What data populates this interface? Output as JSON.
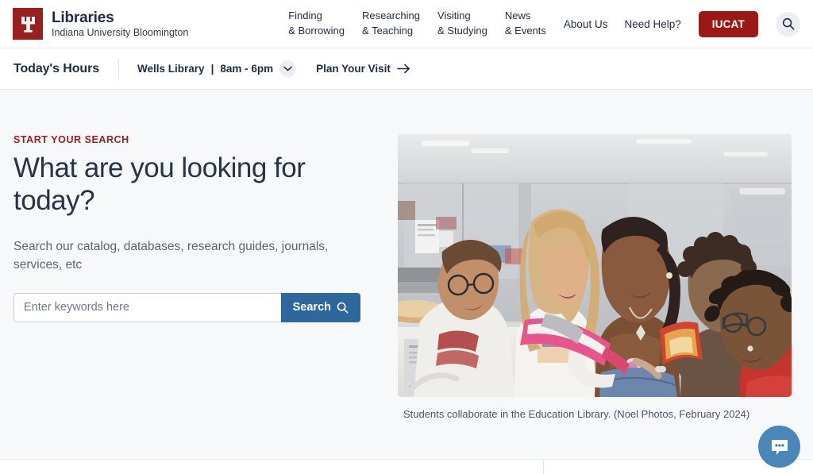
{
  "header": {
    "logo_alt": "Indiana University trident logo",
    "brand_title": "Libraries",
    "brand_subtitle": "Indiana University Bloomington",
    "nav_stacked": [
      {
        "line1": "Finding",
        "line2": "& Borrowing"
      },
      {
        "line1": "Researching",
        "line2": "& Teaching"
      },
      {
        "line1": "Visiting",
        "line2": "& Studying"
      },
      {
        "line1": "News",
        "line2": "& Events"
      }
    ],
    "nav_flat": [
      {
        "label": "About Us"
      },
      {
        "label": "Need Help?"
      }
    ],
    "iucat_label": "IUCAT",
    "search_icon": "search-icon"
  },
  "hours": {
    "title": "Today's Hours",
    "library": "Wells Library",
    "separator": "|",
    "time": "8am - 6pm",
    "chevron_icon": "chevron-down-icon",
    "plan_visit_label": "Plan Your Visit",
    "arrow_icon": "arrow-right-icon"
  },
  "hero": {
    "eyebrow": "START YOUR SEARCH",
    "heading": "What are you looking for today?",
    "description": "Search our catalog, databases, research guides, journals, services, etc",
    "search_placeholder": "Enter keywords here",
    "search_value": "",
    "search_button_label": "Search",
    "search_button_icon": "search-icon",
    "image_caption": "Students collaborate in the Education Library. (Noel Photos, February 2024)"
  },
  "chat": {
    "icon": "chat-bubble-icon",
    "label": "Chat"
  },
  "colors": {
    "crimson": "#9a2020",
    "iucat_red": "#9a1915",
    "search_blue": "#2e679e",
    "chat_blue": "#4a86b8",
    "page_bg": "#f7f8fa",
    "text_dark": "#1f2a44",
    "text_muted": "#5b6375"
  }
}
